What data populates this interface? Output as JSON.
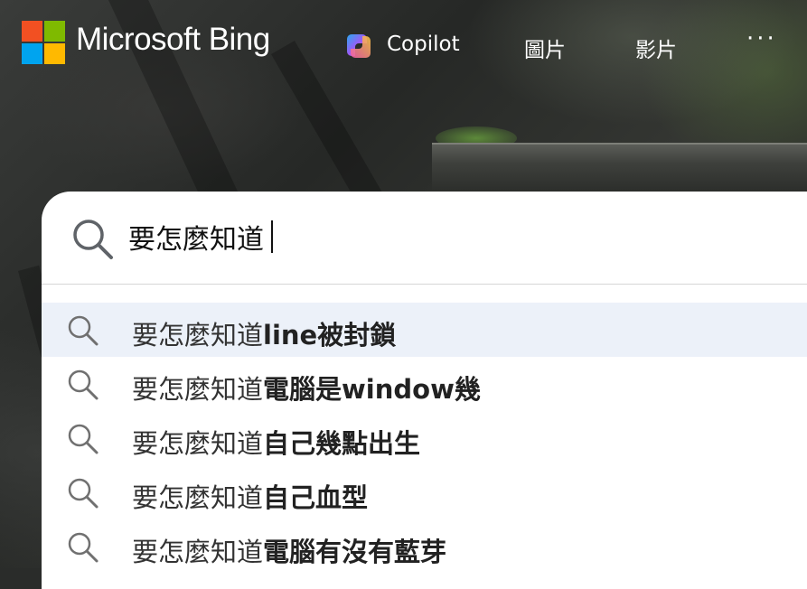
{
  "header": {
    "brand": "Microsoft Bing",
    "nav": {
      "copilot": "Copilot",
      "images": "圖片",
      "videos": "影片",
      "more": "···"
    }
  },
  "search": {
    "query": "要怎麼知道",
    "icon": "search-icon"
  },
  "suggestions": [
    {
      "prefix": "要怎麼知道",
      "completion": "line被封鎖"
    },
    {
      "prefix": "要怎麼知道",
      "completion": "電腦是window幾"
    },
    {
      "prefix": "要怎麼知道",
      "completion": "自己幾點出生"
    },
    {
      "prefix": "要怎麼知道",
      "completion": "自己血型"
    },
    {
      "prefix": "要怎麼知道",
      "completion": "電腦有沒有藍芽"
    }
  ],
  "colors": {
    "logo_red": "#f25022",
    "logo_green": "#7fba00",
    "logo_blue": "#00a4ef",
    "logo_yellow": "#ffb900",
    "highlight": "#ecf1f9"
  }
}
